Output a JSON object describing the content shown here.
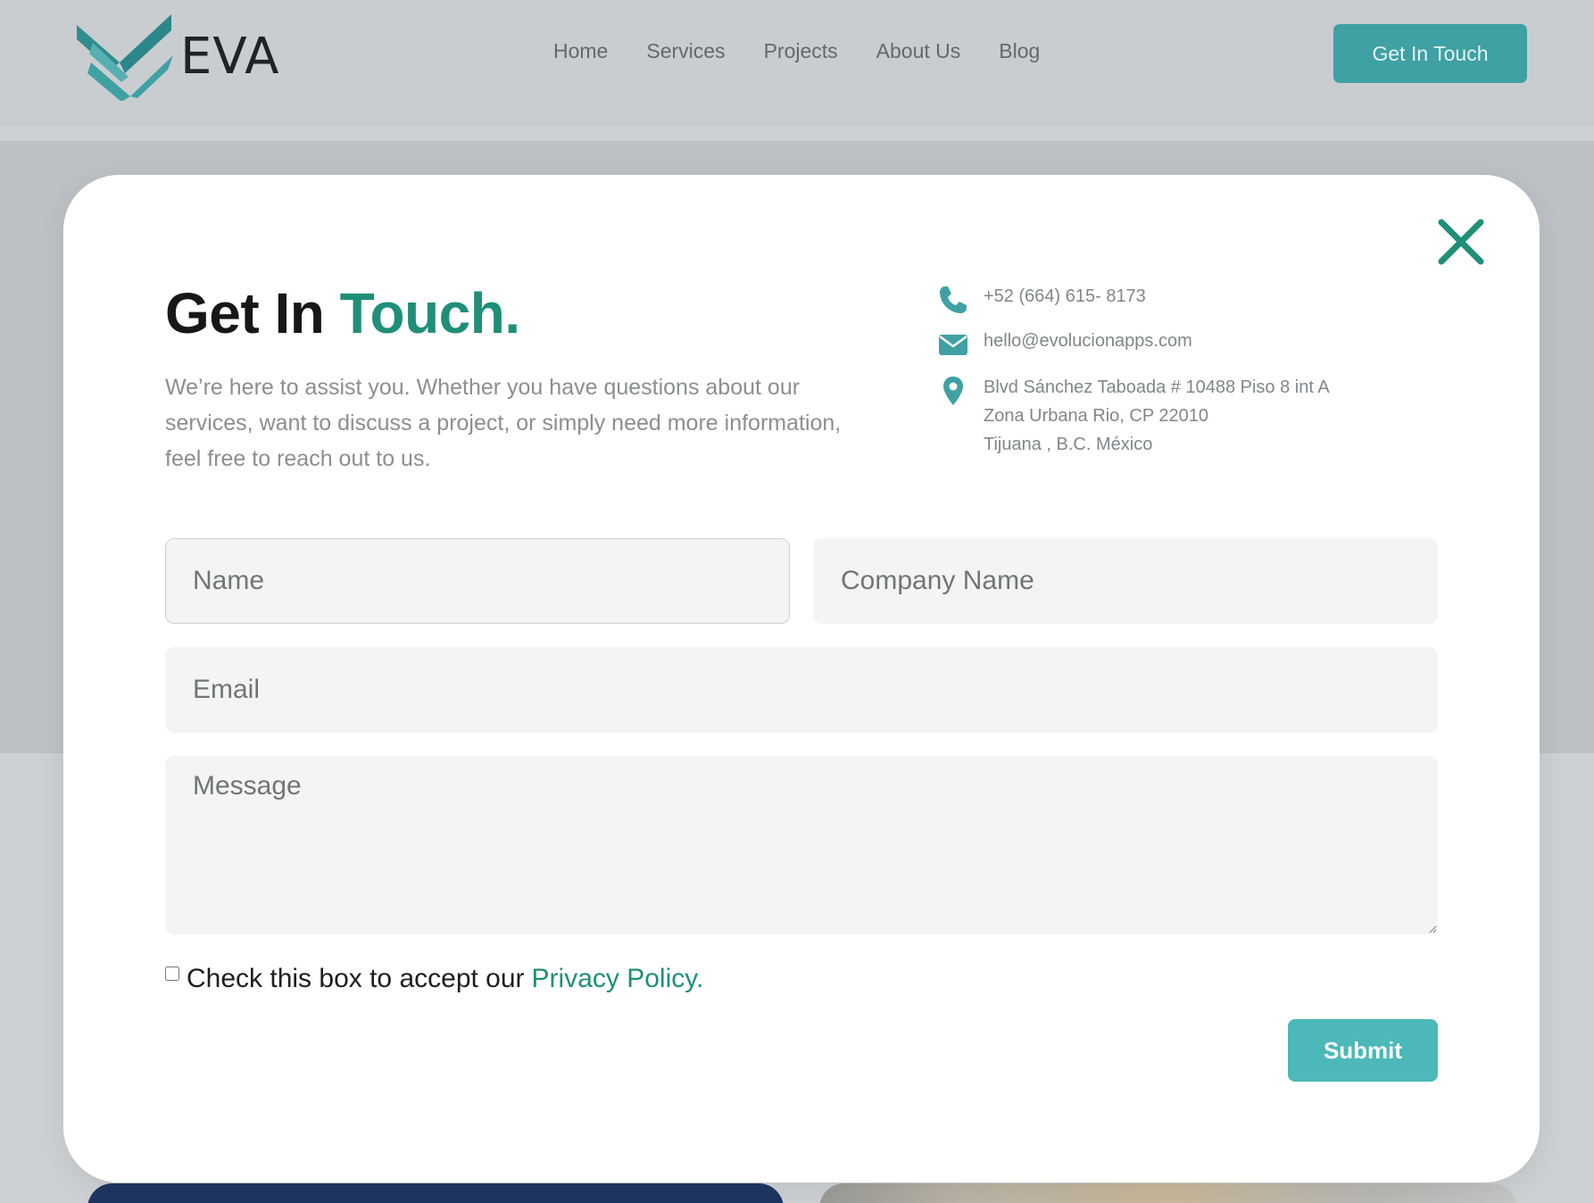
{
  "header": {
    "logo_text": "EVA",
    "nav": [
      "Home",
      "Services",
      "Projects",
      "About Us",
      "Blog"
    ],
    "cta_label": "Get In Touch"
  },
  "modal": {
    "title_main": "Get In",
    "title_accent": "Touch.",
    "description": "We’re here to assist you. Whether you have questions about our services, want to discuss a project, or simply need more information, feel free to reach out to us.",
    "contact": {
      "phone": "+52 (664) 615- 8173",
      "email": "hello@evolucionapps.com",
      "address_lines": [
        "Blvd Sánchez Taboada # 10488 Piso 8 int A",
        "Zona Urbana Rio, CP 22010",
        "Tijuana , B.C. México"
      ]
    },
    "form": {
      "name_placeholder": "Name",
      "company_placeholder": "Company Name",
      "email_placeholder": "Email",
      "message_placeholder": "Message",
      "consent_text": "Check this box to accept our",
      "consent_link": "Privacy Policy.",
      "submit_label": "Submit"
    }
  },
  "colors": {
    "accent_green": "#1f8f78",
    "teal": "#4cb8b9",
    "header_button": "#3fa1a3"
  },
  "icons": [
    "logo-mark-icon",
    "close-icon",
    "phone-icon",
    "envelope-icon",
    "map-pin-icon"
  ]
}
